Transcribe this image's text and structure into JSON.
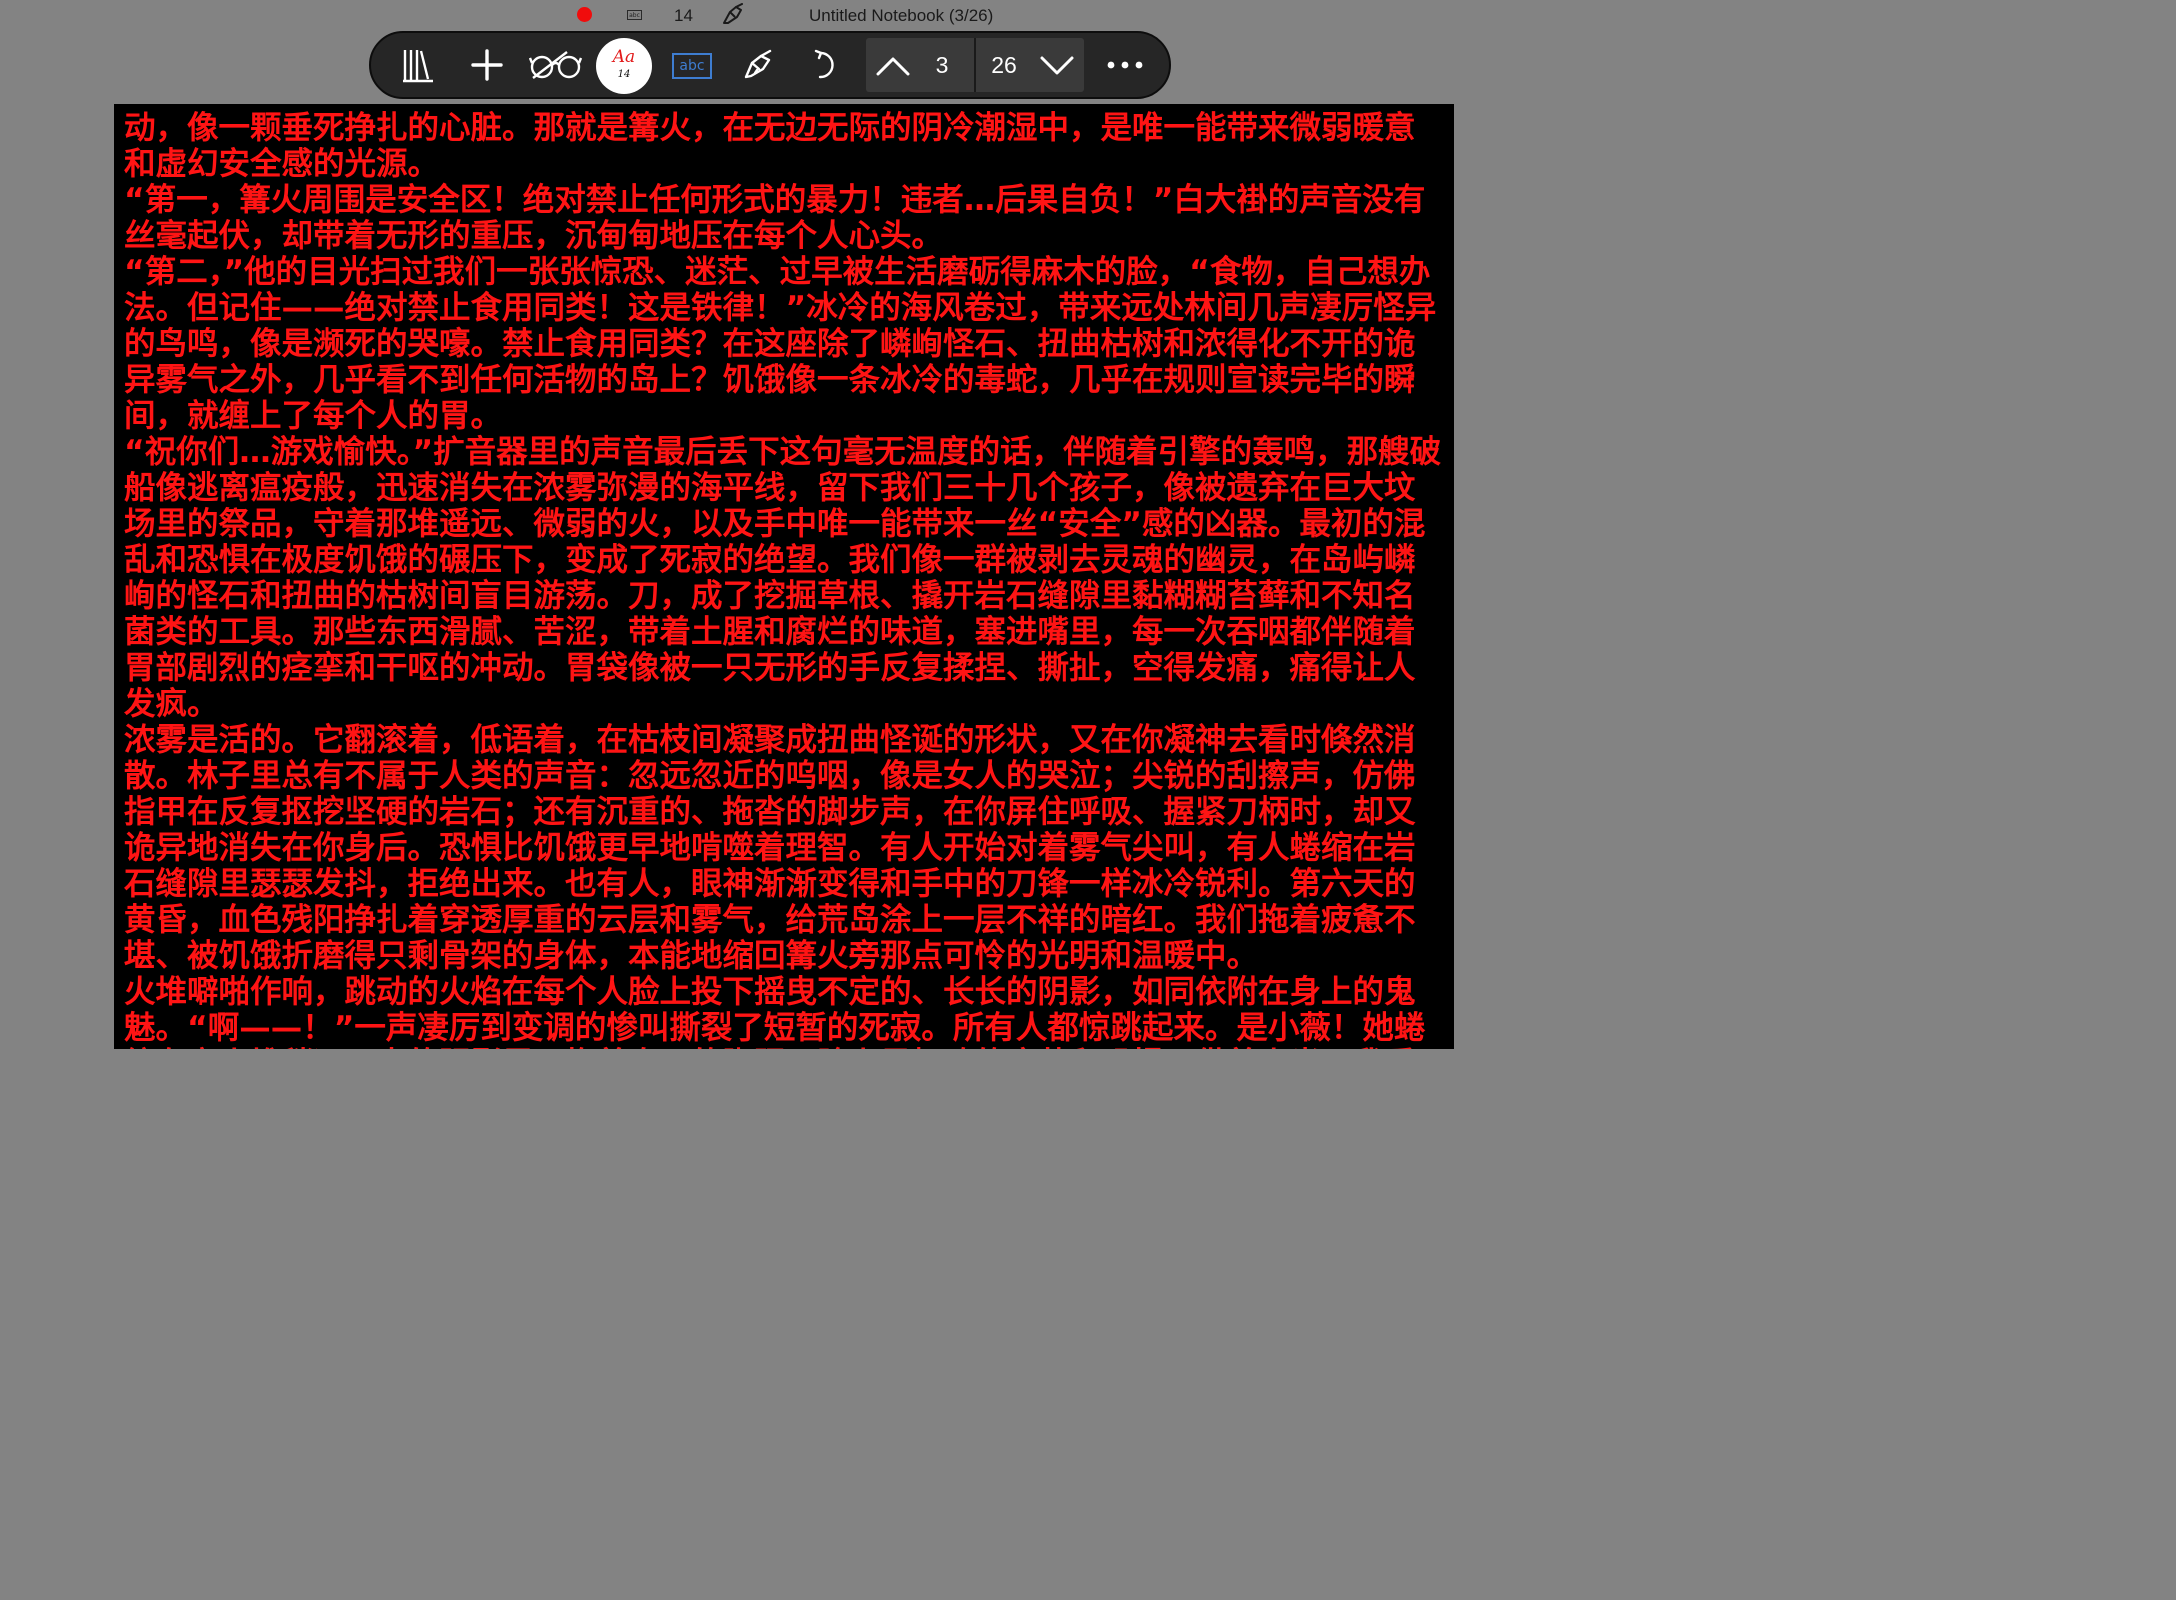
{
  "status_bar": {
    "count": "14",
    "title": "Untitled Notebook (3/26)",
    "record_color": "#f00c0c"
  },
  "toolbar": {
    "icons": [
      "library-icon",
      "plus-icon",
      "reading-glasses-icon",
      "font-style-icon",
      "text-recognition-icon",
      "pen-icon",
      "undo-icon",
      "page-up-icon",
      "page-down-icon",
      "more-icon"
    ],
    "font_button": {
      "label": "Aa",
      "size": "14",
      "color": "#e21b1b"
    },
    "abc_label": "abc",
    "pager": {
      "current": "3",
      "total": "26"
    }
  },
  "page": {
    "background": "#000000",
    "text_color": "#ff1414",
    "paragraphs": [
      "动，像一颗垂死挣扎的心脏。那就是篝火，在无边无际的阴冷潮湿中，是唯一能带来微弱暖意和虚幻安全感的光源。",
      "“第一，篝火周围是安全区！绝对禁止任何形式的暴力！违者…后果自负！”白大褂的声音没有丝毫起伏，却带着无形的重压，沉甸甸地压在每个人心头。",
      "“第二，”他的目光扫过我们一张张惊恐、迷茫、过早被生活磨砺得麻木的脸，“食物，自己想办法。但记住——绝对禁止食用同类！这是铁律！”冰冷的海风卷过，带来远处林间几声凄厉怪异的鸟鸣，像是濒死的哭嚎。禁止食用同类？在这座除了嶙峋怪石、扭曲枯树和浓得化不开的诡异雾气之外，几乎看不到任何活物的岛上？饥饿像一条冰冷的毒蛇，几乎在规则宣读完毕的瞬间，就缠上了每个人的胃。",
      "“祝你们…游戏愉快。”扩音器里的声音最后丢下这句毫无温度的话，伴随着引擎的轰鸣，那艘破船像逃离瘟疫般，迅速消失在浓雾弥漫的海平线，留下我们三十几个孩子，像被遗弃在巨大坟场里的祭品，守着那堆遥远、微弱的火，以及手中唯一能带来一丝“安全”感的凶器。最初的混乱和恐惧在极度饥饿的碾压下，变成了死寂的绝望。我们像一群被剥去灵魂的幽灵，在岛屿嶙峋的怪石和扭曲的枯树间盲目游荡。刀，成了挖掘草根、撬开岩石缝隙里黏糊糊苔藓和不知名菌类的工具。那些东西滑腻、苦涩，带着土腥和腐烂的味道，塞进嘴里，每一次吞咽都伴随着胃部剧烈的痉挛和干呕的冲动。胃袋像被一只无形的手反复揉捏、撕扯，空得发痛，痛得让人发疯。",
      "浓雾是活的。它翻滚着，低语着，在枯枝间凝聚成扭曲怪诞的形状，又在你凝神去看时倏然消散。林子里总有不属于人类的声音：忽远忽近的呜咽，像是女人的哭泣；尖锐的刮擦声，仿佛指甲在反复抠挖坚硬的岩石；还有沉重的、拖沓的脚步声，在你屏住呼吸、握紧刀柄时，却又诡异地消失在你身后。恐惧比饥饿更早地啃噬着理智。有人开始对着雾气尖叫，有人蜷缩在岩石缝隙里瑟瑟发抖，拒绝出来。也有人，眼神渐渐变得和手中的刀锋一样冰冷锐利。第六天的黄昏，血色残阳挣扎着穿透厚重的云层和雾气，给荒岛涂上一层不祥的暗红。我们拖着疲惫不堪、被饥饿折磨得只剩骨架的身体，本能地缩回篝火旁那点可怜的光明和温暖中。",
      "火堆噼啪作响，跳动的火焰在每个人脸上投下摇曳不定的、长长的阴影，如同依附在身上的鬼魅。“啊——！”一声凄厉到变调的惨叫撕裂了短暂的死寂。所有人都惊跳起来。是小薇！她蜷缩在离火堆稍远一点的阴影里，抱着自己的脚踝，脸上是极致的痛苦和恐惧。借着火光，我看到她脚踝上赫然印着几个青黑色的指印！那指印深深凹陷下去，边缘泛着诡异的紫黑色，仿佛被冰水浸透的铁块狠狠钳过，皮肉下"
    ]
  }
}
